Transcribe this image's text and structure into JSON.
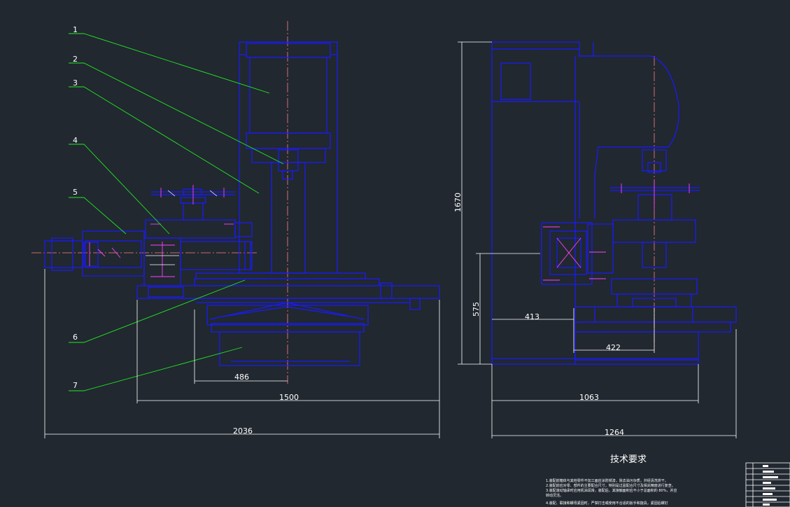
{
  "part_labels": [
    "1",
    "2",
    "3",
    "4",
    "5",
    "6",
    "7"
  ],
  "dimensions": {
    "front_486": "486",
    "front_1500": "1500",
    "front_2036": "2036",
    "side_1670": "1670",
    "side_575": "575",
    "side_413": "413",
    "side_422": "422",
    "side_1063": "1063",
    "side_1264": "1264"
  },
  "tech_requirements": {
    "title": "技术要求",
    "notes": [
      "1.装配前箱体与其他零件不加工面应涂防锈漆，除去油污杂质，并经清洗烘干。",
      "2.装配前应对零、部件的主要配合尺寸，特别是过盈配合尺寸及相关精度进行复查。",
      "3.装配滚动轴承时应用机油润滑，装配后，其接触面积应不小于总面积的 80%，并应",
      "转动灵活。",
      "4.装配、联接和螺母紧固时，严禁打击或使用不合适的扳手和旋具，紧固后螺钉"
    ]
  },
  "colors": {
    "background": "#212830",
    "outline": "#1a1aff",
    "leader": "#22e822",
    "centerline": "#ff8080",
    "dimension": "#ffffff"
  }
}
